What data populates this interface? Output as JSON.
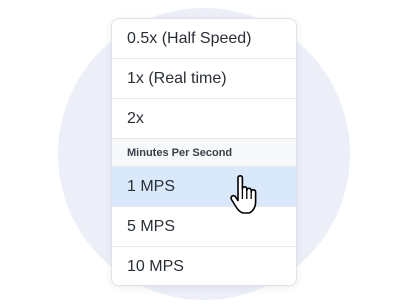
{
  "menu": {
    "speed_items": [
      {
        "label": "0.5x (Half Speed)"
      },
      {
        "label": "1x (Real time)"
      },
      {
        "label": "2x"
      }
    ],
    "section_header": "Minutes Per Second",
    "mps_items": [
      {
        "label": "1 MPS",
        "selected": true
      },
      {
        "label": "5 MPS",
        "selected": false
      },
      {
        "label": "10 MPS",
        "selected": false
      }
    ]
  },
  "cursor": {
    "icon": "hand-pointer-icon"
  },
  "colors": {
    "background_circle": "#eceff8",
    "selected_row": "#d9e8fb",
    "text": "#2a2f36"
  }
}
